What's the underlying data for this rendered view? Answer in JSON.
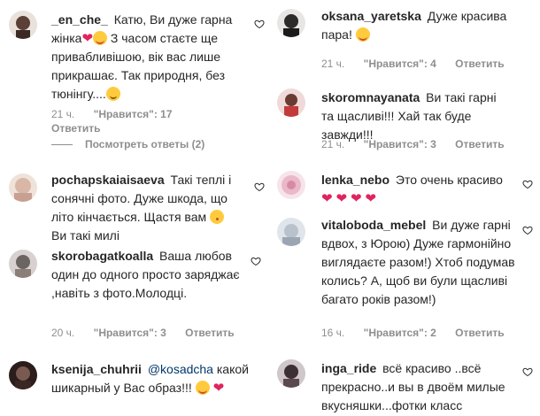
{
  "comments": [
    {
      "username": "_en_che_",
      "text_parts": [
        "Катю, Ви дуже гарна жінка",
        "З часом стаєте ще привабливішою, вік вас лише прикрашає. Так природня, без тюнінгу...."
      ],
      "emojis": [
        "red-heart",
        "smiling-face-with-heart-eyes",
        "relieved-face"
      ],
      "time": "21 ч.",
      "likes": "\"Нравится\": 17",
      "reply_label": "Ответить",
      "view_replies": "Посмотреть ответы (2)",
      "avatar_color": "#5a4036"
    },
    {
      "username": "pochapskaiaisaeva",
      "text_parts": [
        "Такі теплі і сонячні фото. Дуже шкода, що літо кінчається. Щастя вам",
        "Ви такі милі"
      ],
      "emojis": [
        "face-blowing-a-kiss"
      ],
      "avatar_color": "#d9b7a6"
    },
    {
      "username": "skorobagatkoalla",
      "text": "Ваша любов один до одного просто заряджає ,навіть з фото.Молодці.",
      "time": "20 ч.",
      "likes": "\"Нравится\": 3",
      "reply_label": "Ответить",
      "avatar_color": "#6b6460"
    },
    {
      "username": "ksenija_chuhrii",
      "mention": "@kosadcha",
      "text": "какой шикарный у Вас образ!!!",
      "emojis": [
        "smiling-face-with-heart-eyes",
        "red-heart"
      ],
      "avatar_color": "#3a2622"
    },
    {
      "username": "oksana_yaretska",
      "text": "Дуже красива пара!",
      "emojis": [
        "smiling-face-with-heart-eyes"
      ],
      "time": "21 ч.",
      "likes": "\"Нравится\": 4",
      "reply_label": "Ответить",
      "avatar_color": "#2d2a2a"
    },
    {
      "username": "skoromnayanata",
      "text": "Ви такі гарні та щасливі!!! Хай так буде завжди!!!",
      "time": "21 ч.",
      "likes": "\"Нравится\": 3",
      "reply_label": "Ответить",
      "avatar_color": "#c23b3b"
    },
    {
      "username": "lenka_nebo",
      "text": "Это очень красиво",
      "emojis": [
        "red-heart",
        "red-heart",
        "red-heart",
        "red-heart"
      ],
      "avatar_color": "#e9b8c9"
    },
    {
      "username": "vitaloboda_mebel",
      "text": "Ви дуже гарні вдвох, з Юрою) Дуже гармонійно виглядаєте разом!) Хтоб подумав колись? А, щоб ви були щасливі багато років разом!)",
      "time": "16 ч.",
      "likes": "\"Нравится\": 2",
      "reply_label": "Ответить",
      "avatar_color": "#b9c2cc"
    },
    {
      "username": "inga_ride",
      "text": "всё красиво ..всё прекрасно..и вы в двоём милые вкусняшки...фотки класс",
      "avatar_color": "#3c3035"
    }
  ],
  "icons": {
    "like": "heart-outline-icon"
  },
  "colors": {
    "meta": "#8e8e8e",
    "mention": "#00376b",
    "heart": "#ed4956"
  }
}
